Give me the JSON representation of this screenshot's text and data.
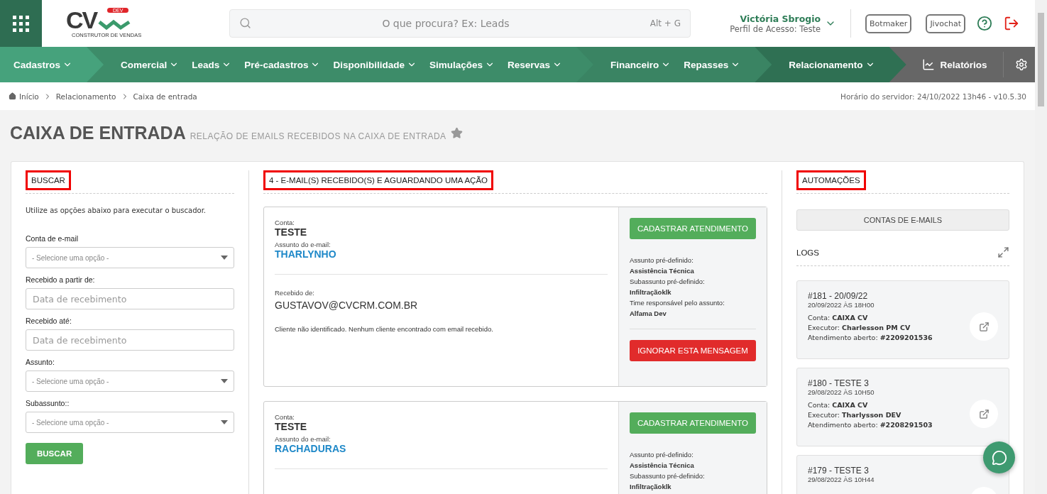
{
  "header": {
    "logo": {
      "text": "CV",
      "badge": "DEV",
      "tagline": "CONSTRUTOR DE VENDAS"
    },
    "search": {
      "placeholder": "O que procura? Ex: Leads",
      "shortcut": "Alt + G"
    },
    "user": {
      "name": "Victória Sbrogio",
      "profile": "Perfil de Acesso: Teste"
    },
    "buttons": [
      "Botmaker",
      "Jivochat"
    ]
  },
  "nav": {
    "groups": [
      {
        "color": "#46a27c",
        "items": [
          "Cadastros"
        ]
      },
      {
        "color": "#3d8c69",
        "items": [
          "Comercial",
          "Leads",
          "Pré-cadastros",
          "Disponibilidade",
          "Simulações",
          "Reservas"
        ]
      },
      {
        "color": "#3a8463",
        "items": [
          "Financeiro",
          "Repasses"
        ]
      },
      {
        "color": "#2f7053",
        "items": [
          "Relacionamento"
        ]
      }
    ],
    "reports": "Relatórios"
  },
  "breadcrumb": [
    "Início",
    "Relacionamento",
    "Caixa de entrada"
  ],
  "server_time": "Horário do servidor: 24/10/2022 13h46 - v10.5.30",
  "page": {
    "title": "CAIXA DE ENTRADA",
    "subtitle": "RELAÇÃO DE EMAILS RECEBIDOS NA CAIXA DE ENTRADA",
    "favorite": false
  },
  "search_panel": {
    "heading": "BUSCAR",
    "highlighted": true,
    "intro": "Utilize as opções abaixo para executar o buscador.",
    "fields": [
      {
        "kind": "select",
        "label": "Conta de e-mail",
        "placeholder": "- Selecione uma opção -"
      },
      {
        "kind": "input",
        "label": "Recebido a partir de:",
        "placeholder": "Data de recebimento"
      },
      {
        "kind": "input",
        "label": "Recebido até:",
        "placeholder": "Data de recebimento"
      },
      {
        "kind": "select",
        "label": "Assunto:",
        "placeholder": "- Selecione uma opção -"
      },
      {
        "kind": "select",
        "label": "Subassunto::",
        "placeholder": "- Selecione uma opção -"
      }
    ],
    "button": "BUSCAR"
  },
  "emails": {
    "heading": "4 - E-MAIL(S) RECEBIDO(S) E AGUARDANDO UMA AÇÃO",
    "highlighted": true,
    "items": [
      {
        "account_label": "Conta:",
        "account": "TESTE",
        "subject_label": "Assunto do e-mail:",
        "subject": "THARLYNHO",
        "from_label": "Recebido de:",
        "from": "GUSTAVOV@CVCRM.COM.BR",
        "note": "Cliente não identificado. Nenhum cliente encontrado com email recebido.",
        "primary_action": "CADASTRAR ATENDIMENTO",
        "details": [
          {
            "label": "Assunto pré-definido:",
            "value": "Assistência Técnica"
          },
          {
            "label": "Subassunto pré-definido:",
            "value": "Infiltraçãoklk"
          },
          {
            "label": "Time responsável pelo assunto:",
            "value": "Alfama Dev"
          }
        ],
        "secondary_action": "IGNORAR ESTA MENSAGEM"
      },
      {
        "account_label": "Conta:",
        "account": "TESTE",
        "subject_label": "Assunto do e-mail:",
        "subject": "RACHADURAS",
        "primary_action": "CADASTRAR ATENDIMENTO",
        "details": [
          {
            "label": "Assunto pré-definido:",
            "value": "Assistência Técnica"
          },
          {
            "label": "Subassunto pré-definido:",
            "value": "Infiltraçãoklk"
          }
        ]
      }
    ]
  },
  "automations": {
    "heading": "AUTOMAÇÕES",
    "highlighted": true,
    "accounts_button": "CONTAS DE E-MAILS",
    "logs_heading": "LOGS",
    "logs": [
      {
        "title": "#181 - 20/09/22",
        "date": "20/09/2022 ÀS 18H00",
        "lines": [
          {
            "label": "Conta:",
            "value": "CAIXA CV"
          },
          {
            "label": "Executor:",
            "value": "Charlesson PM CV"
          },
          {
            "label": "Atendimento aberto:",
            "value": "#2209201536"
          }
        ]
      },
      {
        "title": "#180 - TESTE 3",
        "date": "29/08/2022 ÀS 10H50",
        "lines": [
          {
            "label": "Conta:",
            "value": "CAIXA CV"
          },
          {
            "label": "Executor:",
            "value": "Tharlysson DEV"
          },
          {
            "label": "Atendimento aberto:",
            "value": "#2208291503"
          }
        ]
      },
      {
        "title": "#179 - TESTE 3",
        "date": "29/08/2022 ÀS 10H44"
      }
    ]
  }
}
